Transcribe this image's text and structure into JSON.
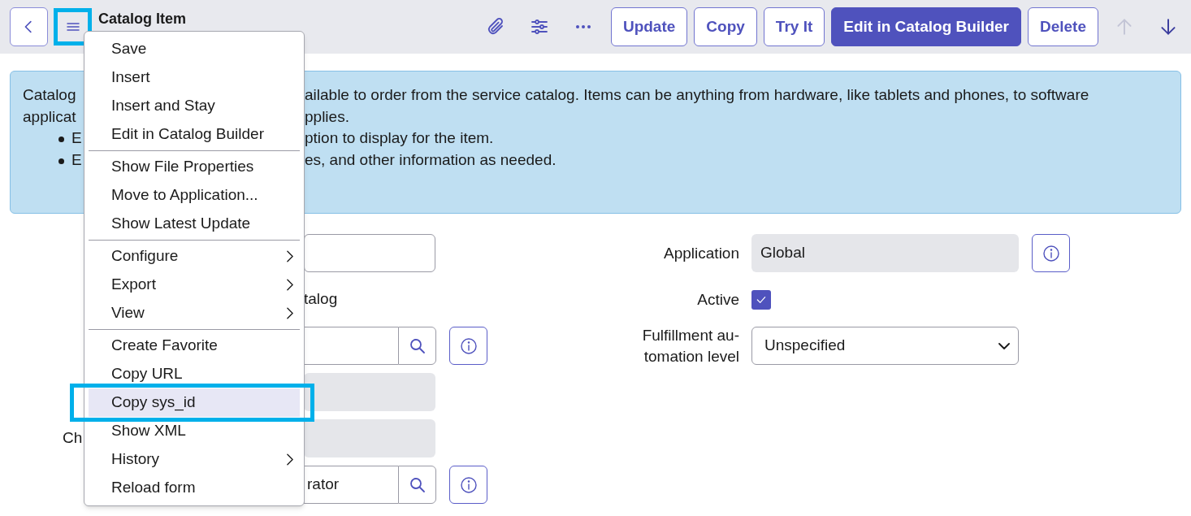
{
  "header": {
    "menu_button": {
      "highlighted": true
    },
    "title": "Catalog Item",
    "toolbar_icons": [
      {
        "kind": "paperclip"
      },
      {
        "kind": "sliders"
      },
      {
        "kind": "more"
      }
    ],
    "buttons": [
      {
        "label": "Update",
        "kind": "outline"
      },
      {
        "label": "Copy",
        "kind": "outline"
      },
      {
        "label": "Try It",
        "kind": "outline"
      },
      {
        "label": "Edit in Catalog Builder",
        "kind": "primary"
      },
      {
        "label": "Delete",
        "kind": "outline"
      }
    ],
    "nav": [
      {
        "kind": "up",
        "disabled": true
      },
      {
        "kind": "down",
        "disabled": false
      }
    ]
  },
  "info": [
    {
      "kind": "text",
      "parts": [
        "Catalog",
        "ailable to order from the service catalog. Items can be anything from hardware, like tablets and phones, to software"
      ]
    },
    {
      "kind": "text",
      "parts": [
        "applicat",
        "pplies."
      ]
    },
    {
      "kind": "bullet",
      "parts": [
        "E",
        "ption to display for the item."
      ]
    },
    {
      "kind": "bullet",
      "parts": [
        "E",
        "es, and other information as needed."
      ]
    }
  ],
  "form_left": [
    {
      "kind": "input"
    },
    {
      "kind": "text",
      "text": "talog"
    },
    {
      "kind": "lookup",
      "info": true
    },
    {
      "kind": "readonly"
    },
    {
      "kind": "readonly",
      "label": "Ch"
    },
    {
      "kind": "lookup",
      "value": "rator",
      "info": true
    }
  ],
  "form_right": [
    {
      "label_lines": [
        "Application"
      ],
      "kind": "readonly",
      "value": "Global",
      "info": true
    },
    {
      "label_lines": [
        "Active"
      ],
      "kind": "checkbox",
      "checked": true
    },
    {
      "label_lines": [
        "Fulfillment au-",
        "tomation level"
      ],
      "kind": "select",
      "value": "Unspecified"
    }
  ],
  "menu": [
    {
      "kind": "item",
      "label": "Save",
      "selected": false
    },
    {
      "kind": "item",
      "label": "Insert",
      "selected": false
    },
    {
      "kind": "item",
      "label": "Insert and Stay",
      "selected": false
    },
    {
      "kind": "item",
      "label": "Edit in Catalog Builder",
      "selected": false
    },
    {
      "kind": "separator"
    },
    {
      "kind": "item",
      "label": "Show File Properties",
      "selected": false
    },
    {
      "kind": "item",
      "label": "Move to Application...",
      "selected": false
    },
    {
      "kind": "item",
      "label": "Show Latest Update",
      "selected": false
    },
    {
      "kind": "separator"
    },
    {
      "kind": "item",
      "label": "Configure",
      "submenu": true,
      "selected": false
    },
    {
      "kind": "item",
      "label": "Export",
      "submenu": true,
      "selected": false
    },
    {
      "kind": "item",
      "label": "View",
      "submenu": true,
      "selected": false
    },
    {
      "kind": "separator"
    },
    {
      "kind": "item",
      "label": "Create Favorite",
      "selected": false
    },
    {
      "kind": "item",
      "label": "Copy URL",
      "selected": false
    },
    {
      "kind": "item",
      "label": "Copy sys_id",
      "selected": true,
      "highlighted": true
    },
    {
      "kind": "item",
      "label": "Show XML",
      "selected": false
    },
    {
      "kind": "item",
      "label": "History",
      "submenu": true,
      "selected": false
    },
    {
      "kind": "item",
      "label": "Reload form",
      "selected": false
    }
  ]
}
